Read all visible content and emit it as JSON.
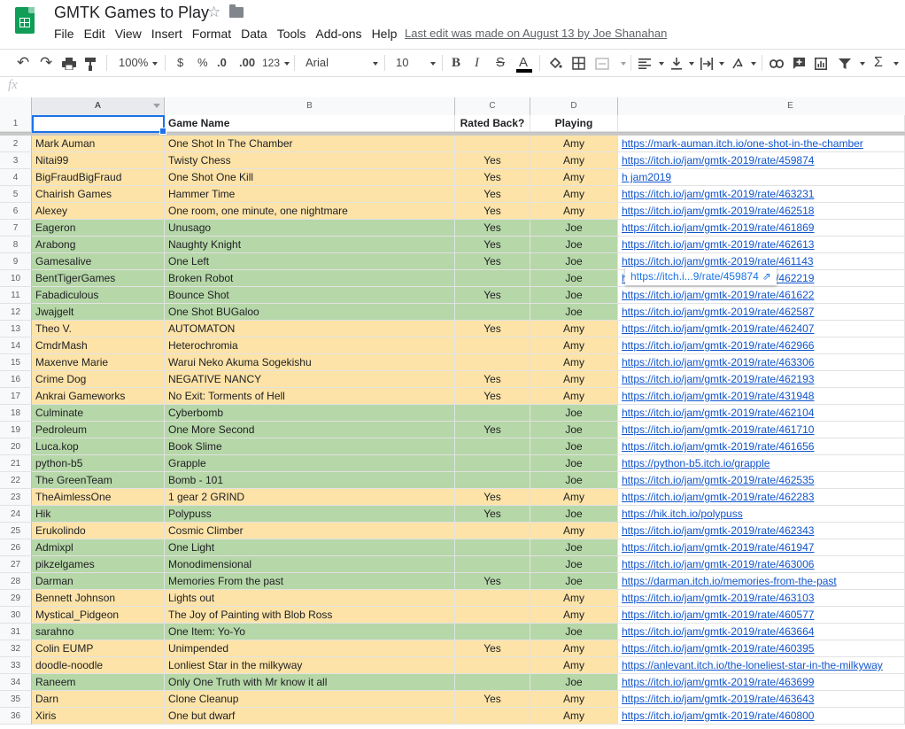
{
  "doc": {
    "title": "GMTK Games to Play",
    "last_edit": "Last edit was made on August 13 by Joe Shanahan"
  },
  "menu": [
    "File",
    "Edit",
    "View",
    "Insert",
    "Format",
    "Data",
    "Tools",
    "Add-ons",
    "Help"
  ],
  "toolbar": {
    "zoom": "100%",
    "currency": "$",
    "percent": "%",
    "dec_decrease": ".0",
    "dec_increase": ".00",
    "format_more": "123",
    "font": "Arial",
    "font_size": "10",
    "bold": "B",
    "italic": "I",
    "strike": "S",
    "text_color": "A",
    "sum": "Σ"
  },
  "formula_bar": {
    "fx": "fx",
    "value": ""
  },
  "columns": [
    "A",
    "B",
    "C",
    "D",
    "E"
  ],
  "header_row": {
    "num": "1",
    "a": "",
    "b": "Game Name",
    "c": "Rated Back?",
    "d": "Playing",
    "e": ""
  },
  "link_popup": {
    "text": "https://itch.i...9/rate/459874"
  },
  "colors": {
    "amy": "#fde3a7",
    "joe": "#b6d7a8",
    "link": "#1155cc",
    "selection": "#1a73e8"
  },
  "rows": [
    {
      "num": "2",
      "author": "Mark Auman",
      "game": "One Shot In The Chamber",
      "rated": "",
      "playing": "Amy",
      "link": "https://mark-auman.itch.io/one-shot-in-the-chamber"
    },
    {
      "num": "3",
      "author": "Nitai99",
      "game": "Twisty Chess",
      "rated": "Yes",
      "playing": "Amy",
      "link": "https://itch.io/jam/gmtk-2019/rate/459874"
    },
    {
      "num": "4",
      "author": "BigFraudBigFraud",
      "game": "One Shot One Kill",
      "rated": "Yes",
      "playing": "Amy",
      "link": "h                                          jam2019"
    },
    {
      "num": "5",
      "author": "Chairish Games",
      "game": "Hammer Time",
      "rated": "Yes",
      "playing": "Amy",
      "link": "https://itch.io/jam/gmtk-2019/rate/463231"
    },
    {
      "num": "6",
      "author": "Alexey",
      "game": "One room, one minute, one nightmare",
      "rated": "Yes",
      "playing": "Amy",
      "link": "https://itch.io/jam/gmtk-2019/rate/462518"
    },
    {
      "num": "7",
      "author": "Eageron",
      "game": "Unusago",
      "rated": "Yes",
      "playing": "Joe",
      "link": "https://itch.io/jam/gmtk-2019/rate/461869"
    },
    {
      "num": "8",
      "author": "Arabong",
      "game": "Naughty Knight",
      "rated": "Yes",
      "playing": "Joe",
      "link": "https://itch.io/jam/gmtk-2019/rate/462613"
    },
    {
      "num": "9",
      "author": "Gamesalive",
      "game": "One Left",
      "rated": "Yes",
      "playing": "Joe",
      "link": "https://itch.io/jam/gmtk-2019/rate/461143"
    },
    {
      "num": "10",
      "author": "BentTigerGames",
      "game": "Broken Robot",
      "rated": "",
      "playing": "Joe",
      "link": "https://itch.io/jam/gmtk-2019/rate/462219"
    },
    {
      "num": "11",
      "author": "Fabadiculous",
      "game": "Bounce Shot",
      "rated": "Yes",
      "playing": "Joe",
      "link": "https://itch.io/jam/gmtk-2019/rate/461622"
    },
    {
      "num": "12",
      "author": "Jwajgelt",
      "game": "One Shot BUGaloo",
      "rated": "",
      "playing": "Joe",
      "link": "https://itch.io/jam/gmtk-2019/rate/462587"
    },
    {
      "num": "13",
      "author": "Theo V.",
      "game": "AUTOMATON",
      "rated": "Yes",
      "playing": "Amy",
      "link": "https://itch.io/jam/gmtk-2019/rate/462407"
    },
    {
      "num": "14",
      "author": "CmdrMash",
      "game": "Heterochromia",
      "rated": "",
      "playing": "Amy",
      "link": "https://itch.io/jam/gmtk-2019/rate/462966"
    },
    {
      "num": "15",
      "author": "Maxenve Marie",
      "game": "Warui Neko Akuma Sogekishu",
      "rated": "",
      "playing": "Amy",
      "link": "https://itch.io/jam/gmtk-2019/rate/463306"
    },
    {
      "num": "16",
      "author": "Crime Dog",
      "game": "NEGATIVE NANCY",
      "rated": "Yes",
      "playing": "Amy",
      "link": "https://itch.io/jam/gmtk-2019/rate/462193"
    },
    {
      "num": "17",
      "author": "Ankrai Gameworks",
      "game": "No Exit: Torments of Hell",
      "rated": "Yes",
      "playing": "Amy",
      "link": "https://itch.io/jam/gmtk-2019/rate/431948"
    },
    {
      "num": "18",
      "author": "Culminate",
      "game": "Cyberbomb",
      "rated": "",
      "playing": "Joe",
      "link": "https://itch.io/jam/gmtk-2019/rate/462104"
    },
    {
      "num": "19",
      "author": "Pedroleum",
      "game": "One More Second",
      "rated": "Yes",
      "playing": "Joe",
      "link": "https://itch.io/jam/gmtk-2019/rate/461710"
    },
    {
      "num": "20",
      "author": "Luca.kop",
      "game": "Book Slime",
      "rated": "",
      "playing": "Joe",
      "link": "https://itch.io/jam/gmtk-2019/rate/461656"
    },
    {
      "num": "21",
      "author": "python-b5",
      "game": "Grapple",
      "rated": "",
      "playing": "Joe",
      "link": "https://python-b5.itch.io/grapple"
    },
    {
      "num": "22",
      "author": "The GreenTeam",
      "game": "Bomb - 101",
      "rated": "",
      "playing": "Joe",
      "link": "https://itch.io/jam/gmtk-2019/rate/462535"
    },
    {
      "num": "23",
      "author": "TheAimlessOne",
      "game": "1 gear 2 GRIND",
      "rated": "Yes",
      "playing": "Amy",
      "link": "https://itch.io/jam/gmtk-2019/rate/462283"
    },
    {
      "num": "24",
      "author": "Hik",
      "game": "Polypuss",
      "rated": "Yes",
      "playing": "Joe",
      "link": "https://hik.itch.io/polypuss"
    },
    {
      "num": "25",
      "author": "Erukolindo",
      "game": "Cosmic Climber",
      "rated": "",
      "playing": "Amy",
      "link": "https://itch.io/jam/gmtk-2019/rate/462343"
    },
    {
      "num": "26",
      "author": "Admixpl",
      "game": "One Light",
      "rated": "",
      "playing": "Joe",
      "link": "https://itch.io/jam/gmtk-2019/rate/461947"
    },
    {
      "num": "27",
      "author": "pikzelgames",
      "game": "Monodimensional",
      "rated": "",
      "playing": "Joe",
      "link": "https://itch.io/jam/gmtk-2019/rate/463006"
    },
    {
      "num": "28",
      "author": "Darman",
      "game": "Memories From the past",
      "rated": "Yes",
      "playing": "Joe",
      "link": "https://darman.itch.io/memories-from-the-past"
    },
    {
      "num": "29",
      "author": "Bennett Johnson",
      "game": "Lights out",
      "rated": "",
      "playing": "Amy",
      "link": "https://itch.io/jam/gmtk-2019/rate/463103"
    },
    {
      "num": "30",
      "author": "Mystical_Pidgeon",
      "game": "The Joy of Painting with Blob Ross",
      "rated": "",
      "playing": "Amy",
      "link": "https://itch.io/jam/gmtk-2019/rate/460577"
    },
    {
      "num": "31",
      "author": "sarahno",
      "game": "One Item: Yo-Yo",
      "rated": "",
      "playing": "Joe",
      "link": "https://itch.io/jam/gmtk-2019/rate/463664"
    },
    {
      "num": "32",
      "author": "Colin EUMP",
      "game": "Unimpended",
      "rated": "Yes",
      "playing": "Amy",
      "link": "https://itch.io/jam/gmtk-2019/rate/460395"
    },
    {
      "num": "33",
      "author": "doodle-noodle",
      "game": "Lonliest Star in the milkyway",
      "rated": "",
      "playing": "Amy",
      "link": "https://anlevant.itch.io/the-loneliest-star-in-the-milkyway"
    },
    {
      "num": "34",
      "author": "Raneem",
      "game": "Only One Truth with Mr know it all",
      "rated": "",
      "playing": "Joe",
      "link": "https://itch.io/jam/gmtk-2019/rate/463699"
    },
    {
      "num": "35",
      "author": "Darn",
      "game": "Clone Cleanup",
      "rated": "Yes",
      "playing": "Amy",
      "link": "https://itch.io/jam/gmtk-2019/rate/463643"
    },
    {
      "num": "36",
      "author": "Xiris",
      "game": "One but dwarf",
      "rated": "",
      "playing": "Amy",
      "link": "https://itch.io/jam/gmtk-2019/rate/460800"
    }
  ]
}
